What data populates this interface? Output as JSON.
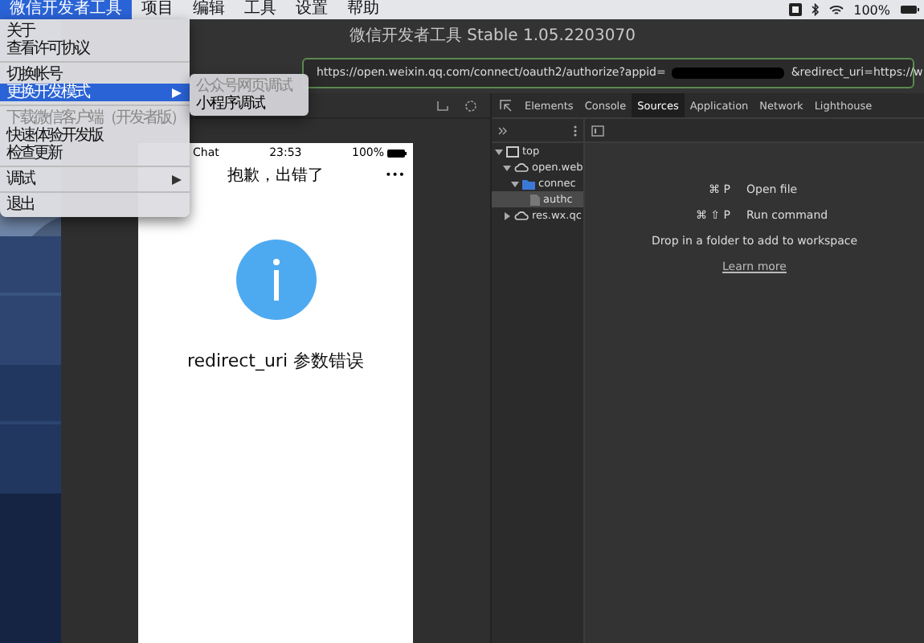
{
  "menu_bar": {
    "items": [
      {
        "label": "微信开发者工具",
        "selected": true
      },
      {
        "label": "项目",
        "selected": false
      },
      {
        "label": "编辑",
        "selected": false
      },
      {
        "label": "工具",
        "selected": false
      },
      {
        "label": "设置",
        "selected": false
      },
      {
        "label": "帮助",
        "selected": false
      }
    ],
    "battery": "100%"
  },
  "app_menu": {
    "items": [
      {
        "kind": "item",
        "label": "关于",
        "disabled": false,
        "selected": false,
        "submenu": false
      },
      {
        "kind": "item",
        "label": "查看许可协议",
        "disabled": false,
        "selected": false,
        "submenu": false
      },
      {
        "kind": "separator"
      },
      {
        "kind": "item",
        "label": "切换帐号",
        "disabled": false,
        "selected": false,
        "submenu": false
      },
      {
        "kind": "item",
        "label": "更换开发模式",
        "disabled": false,
        "selected": true,
        "submenu": true
      },
      {
        "kind": "separator"
      },
      {
        "kind": "item",
        "label": "下载微信客户端（开发者版）",
        "disabled": true,
        "selected": false,
        "submenu": false
      },
      {
        "kind": "item",
        "label": "快速体验开发版",
        "disabled": false,
        "selected": false,
        "submenu": false
      },
      {
        "kind": "item",
        "label": "检查更新",
        "disabled": false,
        "selected": false,
        "submenu": false
      },
      {
        "kind": "separator"
      },
      {
        "kind": "item",
        "label": "调试",
        "disabled": false,
        "selected": false,
        "submenu": true
      },
      {
        "kind": "separator"
      },
      {
        "kind": "item",
        "label": "退出",
        "disabled": false,
        "selected": false,
        "submenu": false
      }
    ]
  },
  "submenu": {
    "items": [
      {
        "label": "公众号网页调试",
        "disabled": true
      },
      {
        "label": "小程序调试",
        "disabled": false
      }
    ]
  },
  "window": {
    "title": "微信开发者工具 Stable 1.05.2203070"
  },
  "address_bar": {
    "url_start": "https://open.weixin.qq.com/connect/oauth2/authorize?appid=",
    "url_end": "&redirect_uri=https://w"
  },
  "simulator": {
    "status_bar": {
      "carrier": "Chat",
      "time": "23:53",
      "battery": "100%"
    },
    "nav_title": "抱歉，出错了",
    "more": "•••",
    "message": "redirect_uri 参数错误"
  },
  "devtools": {
    "tabs": [
      {
        "label": "Elements",
        "selected": false
      },
      {
        "label": "Console",
        "selected": false
      },
      {
        "label": "Sources",
        "selected": true
      },
      {
        "label": "Application",
        "selected": false
      },
      {
        "label": "Network",
        "selected": false
      },
      {
        "label": "Lighthouse",
        "selected": false
      }
    ],
    "tree": [
      {
        "kind": "frame",
        "label": "top",
        "expanded": true,
        "selected": false,
        "children": [
          {
            "kind": "domain",
            "label": "open.web",
            "expanded": true,
            "selected": false,
            "children": [
              {
                "kind": "folder",
                "label": "connec",
                "expanded": true,
                "selected": false,
                "children": [
                  {
                    "kind": "file",
                    "label": "authc",
                    "selected": true
                  }
                ]
              }
            ]
          },
          {
            "kind": "domain",
            "label": "res.wx.qc",
            "expanded": false,
            "selected": false
          }
        ]
      }
    ],
    "shortcuts": [
      {
        "keys": "⌘ P",
        "label": "Open file"
      },
      {
        "keys": "⌘ ⇧ P",
        "label": "Run command"
      }
    ],
    "hint": "Drop in a folder to add to workspace",
    "link": "Learn more"
  }
}
